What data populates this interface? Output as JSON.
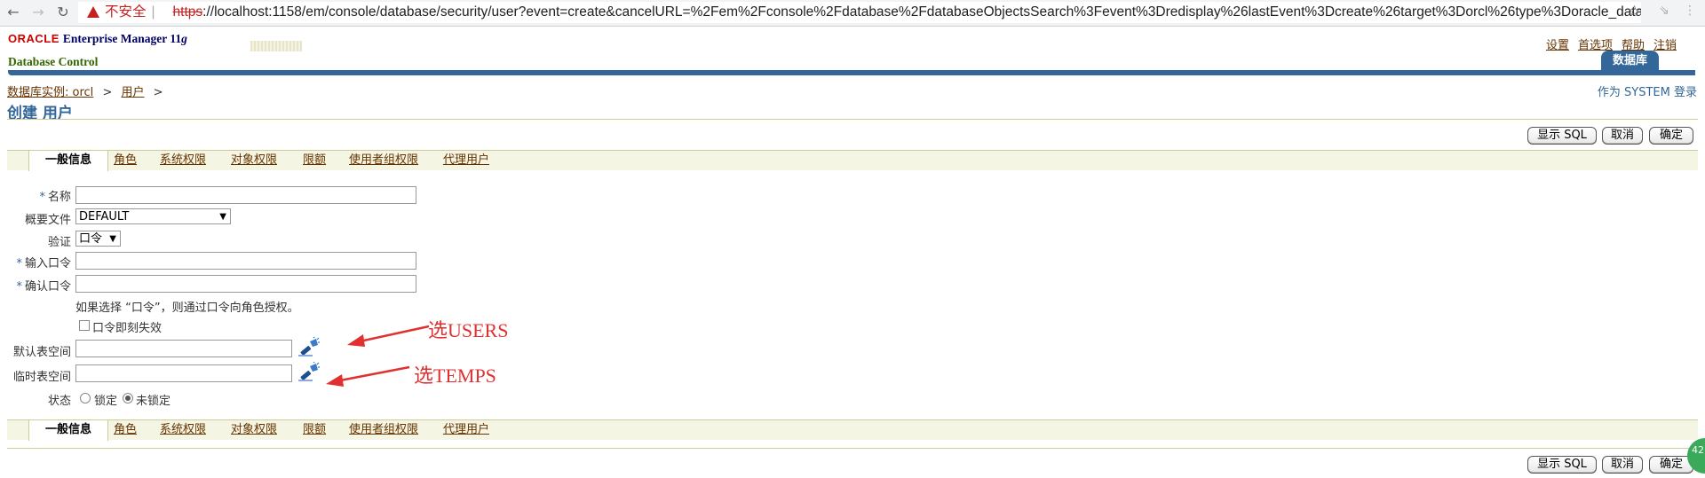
{
  "browser": {
    "warning_label": "不安全",
    "url_scheme": "https",
    "url_rest": "://localhost:1158/em/console/database/security/user?event=create&cancelURL=%2Fem%2Fconsole%2Fdatabase%2FdatabaseObjectsSearch%3Fevent%3Dredisplay%26lastEvent%3Dcreate%26target%3Dorcl%26type%3Doracle_database%..."
  },
  "header": {
    "oracle": "ORACLE",
    "em_title": "Enterprise Manager 11",
    "em_version": "g",
    "subtitle": "Database Control",
    "links": [
      "设置",
      "首选项",
      "帮助",
      "注销"
    ],
    "db_tab": "数据库"
  },
  "breadcrumb": {
    "instance": "数据库实例: orcl",
    "users": "用户",
    "sep": ">"
  },
  "logged_in": "作为 SYSTEM 登录",
  "page_title": "创建 用户",
  "buttons": {
    "show_sql": "显示 SQL",
    "cancel": "取消",
    "ok": "确定"
  },
  "tabs": [
    "一般信息",
    "角色",
    "系统权限",
    "对象权限",
    "限额",
    "使用者组权限",
    "代理用户"
  ],
  "form": {
    "req": "*",
    "name_label": "名称",
    "profile_label": "概要文件",
    "profile_value": "DEFAULT",
    "auth_label": "验证",
    "auth_value": "口令",
    "pwd_label": "输入口令",
    "confirm_label": "确认口令",
    "hint": "如果选择 “口令”，则通过口令向角色授权。",
    "expire_label": "口令即刻失效",
    "default_ts_label": "默认表空间",
    "temp_ts_label": "临时表空间",
    "status_label": "状态",
    "locked_label": "锁定",
    "unlocked_label": "未锁定"
  },
  "annotations": {
    "users": "选USERS",
    "temps": "选TEMPS",
    "color": "#e03030"
  },
  "badge": "42"
}
